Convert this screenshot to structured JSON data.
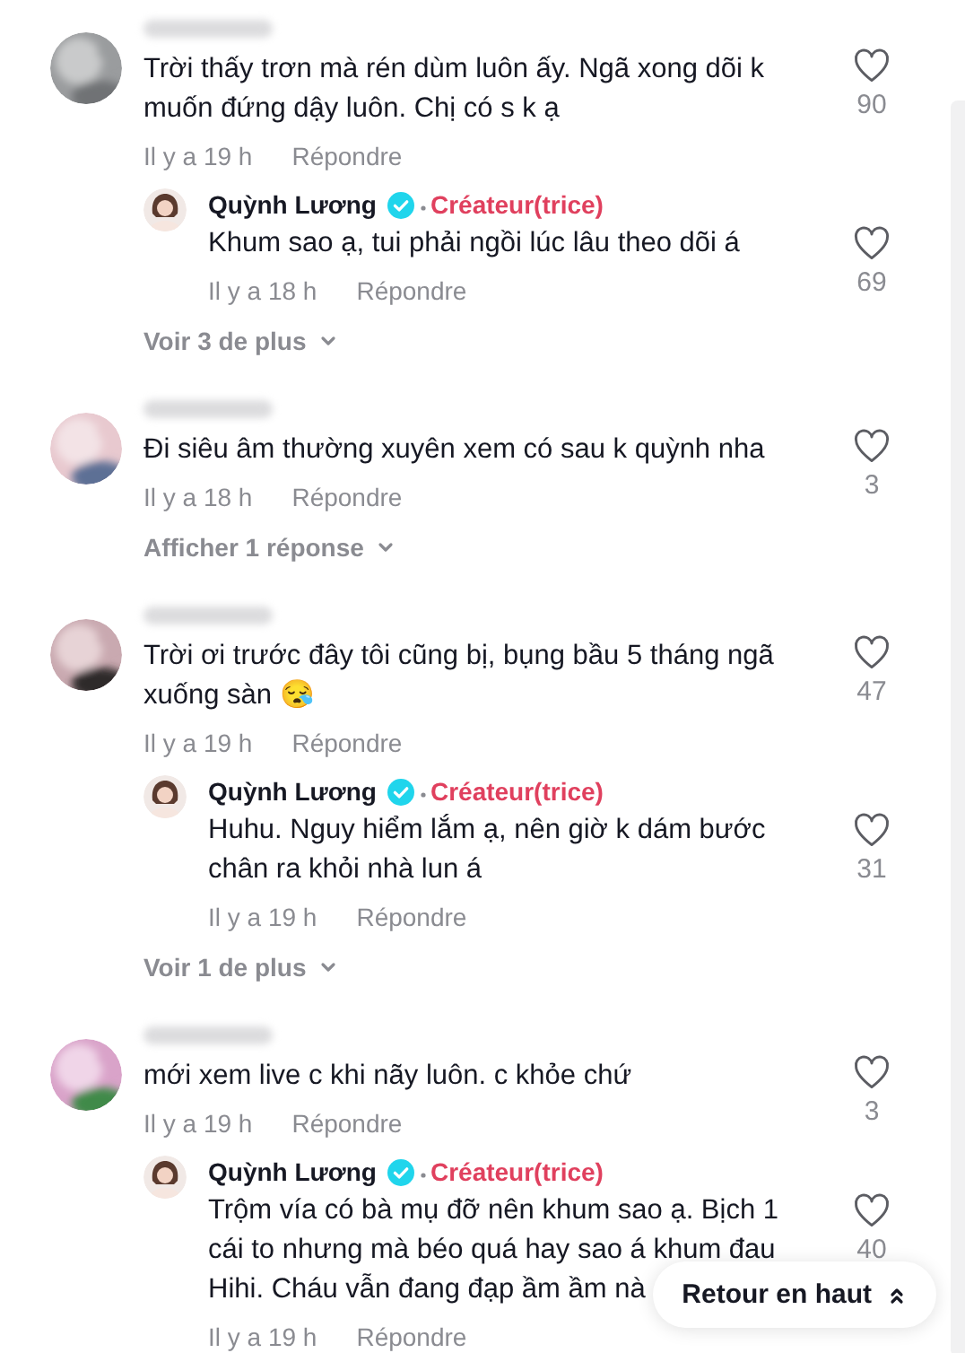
{
  "comments": [
    {
      "avatar": {
        "kind": "picture"
      },
      "text": "Trời thấy trơn mà rén dùm luôn ấy. Ngã xong dõi k muốn đứng dậy luôn. Chị có s k ạ",
      "time": "Il y a 19 h",
      "reply_label": "Répondre",
      "likes": "90",
      "replies": [
        {
          "author": "Quỳnh Lương",
          "verified": true,
          "badge": "Créateur(trice)",
          "paragraphs": [
            "Khum sao ạ, tui phải ngồi lúc lâu theo dõi á"
          ],
          "time": "Il y a 18 h",
          "reply_label": "Répondre",
          "likes": "69"
        }
      ],
      "more": "Voir 3 de plus"
    },
    {
      "avatar": {
        "kind": "picture"
      },
      "text": "Đi siêu âm thường xuyên xem có sau k quỳnh nha",
      "time": "Il y a 18 h",
      "reply_label": "Répondre",
      "likes": "3",
      "more": "Afficher 1 réponse"
    },
    {
      "avatar": {
        "kind": "picture"
      },
      "text": "Trời ơi trước đây tôi cũng bị, bụng bầu 5 tháng ngã xuống sàn 😪",
      "time": "Il y a 19 h",
      "reply_label": "Répondre",
      "likes": "47",
      "replies": [
        {
          "author": "Quỳnh Lương",
          "verified": true,
          "badge": "Créateur(trice)",
          "paragraphs": [
            "Huhu. Nguy hiểm lắm ạ, nên giờ k dám bước chân ra khỏi nhà lun á"
          ],
          "time": "Il y a 19 h",
          "reply_label": "Répondre",
          "likes": "31"
        }
      ],
      "more": "Voir 1 de plus"
    },
    {
      "avatar": {
        "kind": "picture"
      },
      "text": "mới xem live c khi nãy luôn. c khỏe chứ",
      "time": "Il y a 19 h",
      "reply_label": "Répondre",
      "likes": "3",
      "replies": [
        {
          "author": "Quỳnh Lương",
          "verified": true,
          "badge": "Créateur(trice)",
          "paragraphs": [
            "Trộm vía có bà mụ đỡ nên khum sao ạ. Bịch 1 cái to nhưng mà béo quá hay sao á khum đau",
            "Hihi. Cháu vẫn đang đạp ầm ầm nà"
          ],
          "time": "Il y a 19 h",
          "reply_label": "Répondre",
          "likes": "40"
        }
      ]
    }
  ],
  "back_to_top": "Retour en haut"
}
